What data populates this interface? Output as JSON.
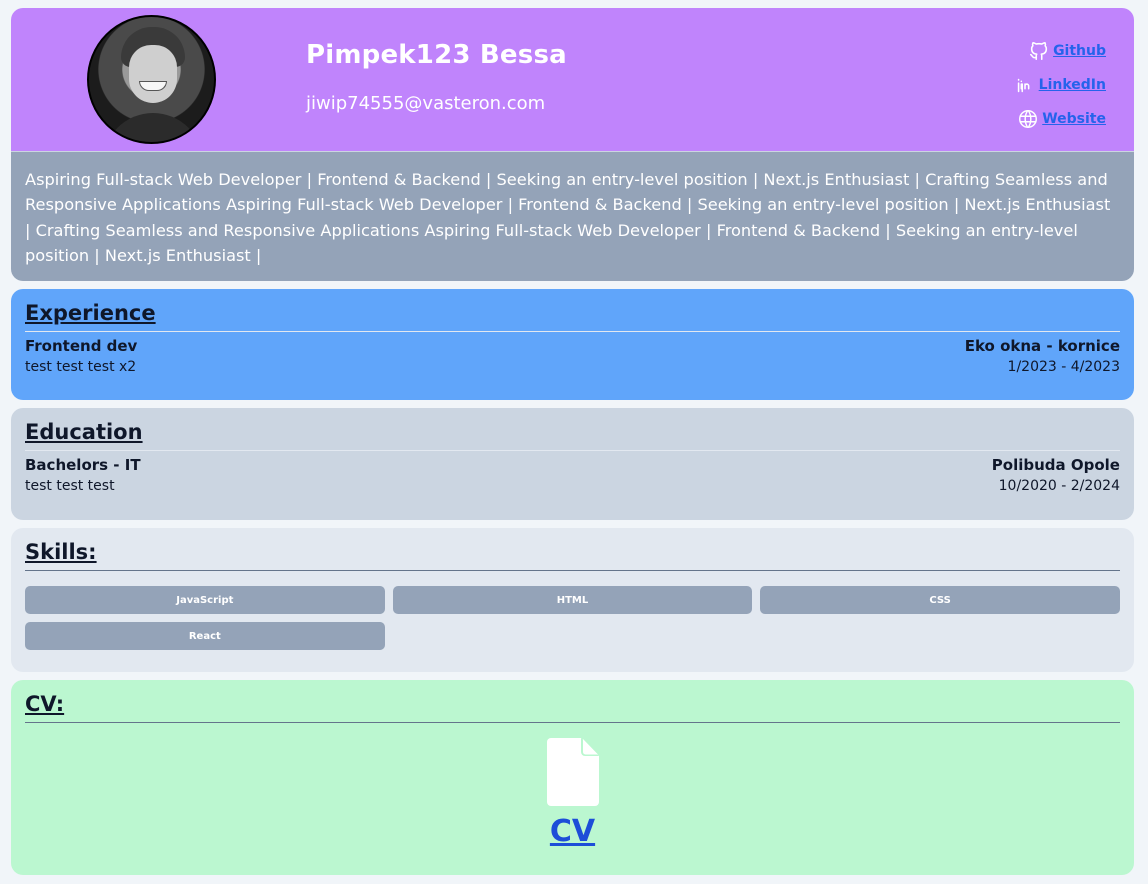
{
  "profile": {
    "name": "Pimpek123 Bessa",
    "email": "jiwip74555@vasteron.com",
    "links": [
      {
        "label": "Github",
        "icon": "github-icon"
      },
      {
        "label": "LinkedIn",
        "icon": "linkedin-icon"
      },
      {
        "label": "Website",
        "icon": "globe-icon"
      }
    ],
    "bio": "Aspiring Full-stack Web Developer | Frontend & Backend | Seeking an entry-level position | Next.js Enthusiast | Crafting Seamless and Responsive Applications Aspiring Full-stack Web Developer | Frontend & Backend | Seeking an entry-level position | Next.js Enthusiast | Crafting Seamless and Responsive Applications Aspiring Full-stack Web Developer | Frontend & Backend | Seeking an entry-level position | Next.js Enthusiast |"
  },
  "experience": {
    "heading": "Experience",
    "items": [
      {
        "title": "Frontend dev",
        "description": "test test test x2",
        "company": "Eko okna - kornice",
        "dates": "1/2023 - 4/2023"
      }
    ]
  },
  "education": {
    "heading": "Education",
    "items": [
      {
        "title": "Bachelors - IT",
        "description": "test test test",
        "school": "Polibuda Opole",
        "dates": "10/2020 - 2/2024"
      }
    ]
  },
  "skills": {
    "heading": "Skills:",
    "items": [
      "JavaScript",
      "HTML",
      "CSS",
      "React"
    ]
  },
  "cv": {
    "heading": "CV:",
    "link_label": "CV",
    "icon": "file-icon"
  },
  "colors": {
    "header_bg": "#c084fc",
    "bio_bg": "#94a3b8",
    "experience_bg": "#60a5fa",
    "education_bg": "#cbd5e1",
    "skills_bg": "#e2e8f0",
    "cv_bg": "#bbf7d0",
    "link": "#2563eb"
  }
}
